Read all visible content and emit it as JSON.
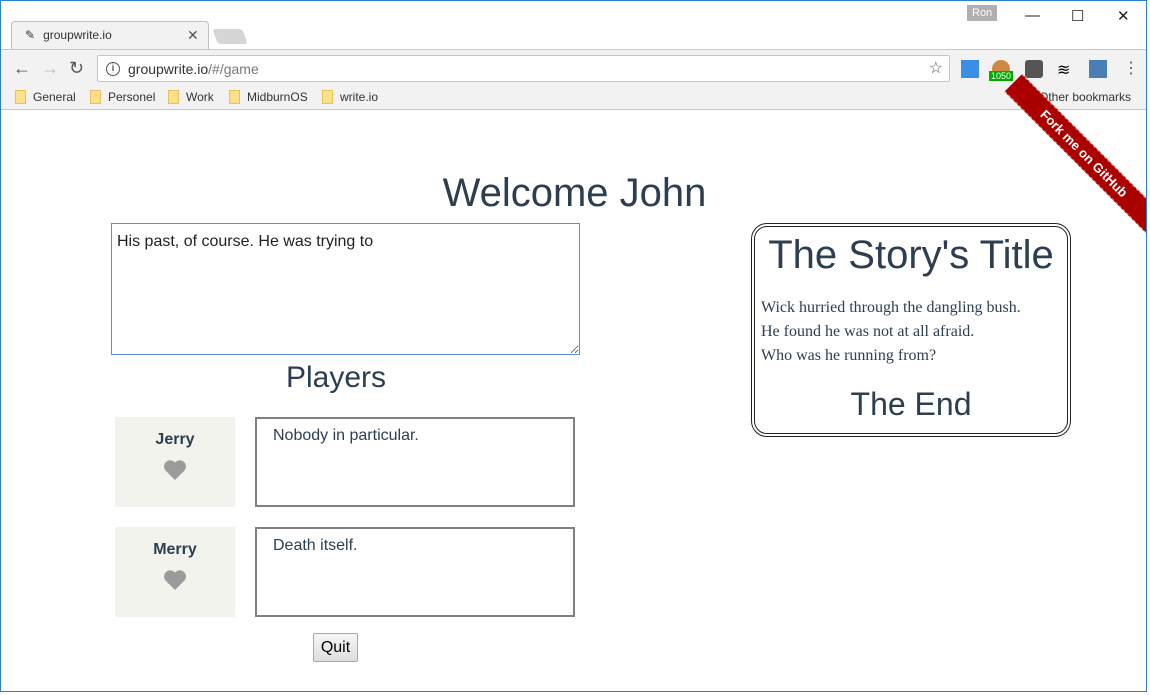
{
  "browser": {
    "tab_title": "groupwrite.io",
    "user": "Ron",
    "url_host": "groupwrite.io",
    "url_path": "/#/game",
    "extension_badge": "1050",
    "bookmarks": [
      "General",
      "Personel",
      "Work",
      "MidburnOS",
      "write.io"
    ],
    "other_bookmarks": "Other bookmarks"
  },
  "page": {
    "welcome": "Welcome John",
    "editor_value": "His past, of course. He was trying to ",
    "players_heading": "Players",
    "players": [
      {
        "name": "Jerry",
        "suggestion": "Nobody in particular."
      },
      {
        "name": "Merry",
        "suggestion": "Death itself."
      }
    ],
    "quit_label": "Quit",
    "story": {
      "title": "The Story's Title",
      "lines": [
        "Wick hurried through the dangling bush.",
        "He found he was not at all afraid.",
        "Who was he running from?"
      ],
      "end": "The End"
    },
    "ribbon": "Fork me on GitHub",
    "colors": {
      "text": "#2c3e50",
      "ribbon": "#aa0000",
      "player_card": "#f3f3ee",
      "heart": "#9b9b9b"
    }
  }
}
